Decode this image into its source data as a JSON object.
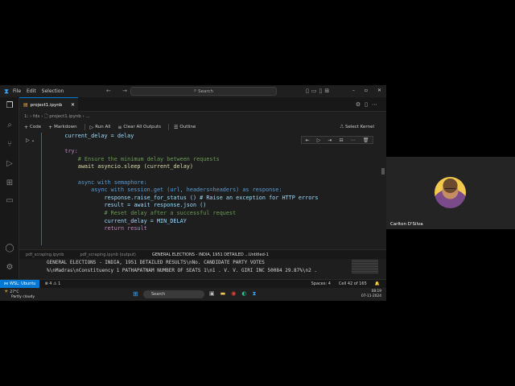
{
  "titlebar": {
    "menu": [
      "File",
      "Edit",
      "Selection"
    ],
    "search_label": "Search",
    "nav_arrows": "← →",
    "window_controls": [
      "–",
      "▫",
      "✕"
    ]
  },
  "tabs": [
    {
      "label": "project1.ipynb",
      "close": "✕"
    }
  ],
  "breadcrumb": "1: › fds › 🗋 project1.ipynb › ...",
  "toolbar": {
    "code": "Code",
    "markdown": "Markdown",
    "run_all": "Run All",
    "clear_outputs": "Clear All Outputs",
    "outline": "Outline",
    "select_kernel": "Select Kernel"
  },
  "code_lines": [
    {
      "indent": 2,
      "text": "current_delay = delay"
    },
    {
      "indent": 0,
      "text": ""
    },
    {
      "indent": 2,
      "text": "try:"
    },
    {
      "indent": 4,
      "text": "# Ensure the minimum delay between requests"
    },
    {
      "indent": 4,
      "text": "await asyncio.sleep (current_delay)"
    },
    {
      "indent": 0,
      "text": ""
    },
    {
      "indent": 4,
      "text": "async with semaphore:"
    },
    {
      "indent": 6,
      "text": "async with session.get (url, headers=headers) as response:"
    },
    {
      "indent": 8,
      "text": "response.raise_for_status () # Raise an exception for HTTP errors"
    },
    {
      "indent": 8,
      "text": "result = await response.json ()"
    },
    {
      "indent": 8,
      "text": "# Reset delay after a successful request"
    },
    {
      "indent": 8,
      "text": "current_delay = MIN_DELAY"
    },
    {
      "indent": 8,
      "text": "return result"
    }
  ],
  "panel": {
    "tabs": [
      "pdf_scraping.ipynb",
      "pdf_scraping.ipynb (output)",
      "GENERAL ELECTIONS - INDIA, 1951 DETAILED ...Untitled-1"
    ],
    "output_lines": [
      "GENERAL ELECTIONS - INDIA, 1951 DETAILED RESULTS\\nNo. CANDIDATE PARTY VOTES",
      "%\\nMadras\\nConstituency 1 PATHAPATNAM NUMBER OF SEATS 1\\n1 . V. V. GIRI INC 50084 29.87%\\n2 ."
    ]
  },
  "statusbar": {
    "remote": "WSL: Ubuntu",
    "problems": "⊗ 4 ⚠ 1",
    "spaces": "Spaces: 4",
    "cell": "Cell 42 of 165"
  },
  "taskbar": {
    "temperature": "27°C",
    "weather": "Partly cloudy",
    "search": "Search",
    "time": "08:19",
    "date": "07-11-2024"
  },
  "webcam": {
    "name": "Carlton D'Silva"
  },
  "colors": {
    "accent": "#0078d4",
    "keyword": "#569cd6",
    "control": "#c586c0",
    "function": "#dcdcaa",
    "comment": "#6a9955",
    "variable": "#9cdcfe"
  }
}
